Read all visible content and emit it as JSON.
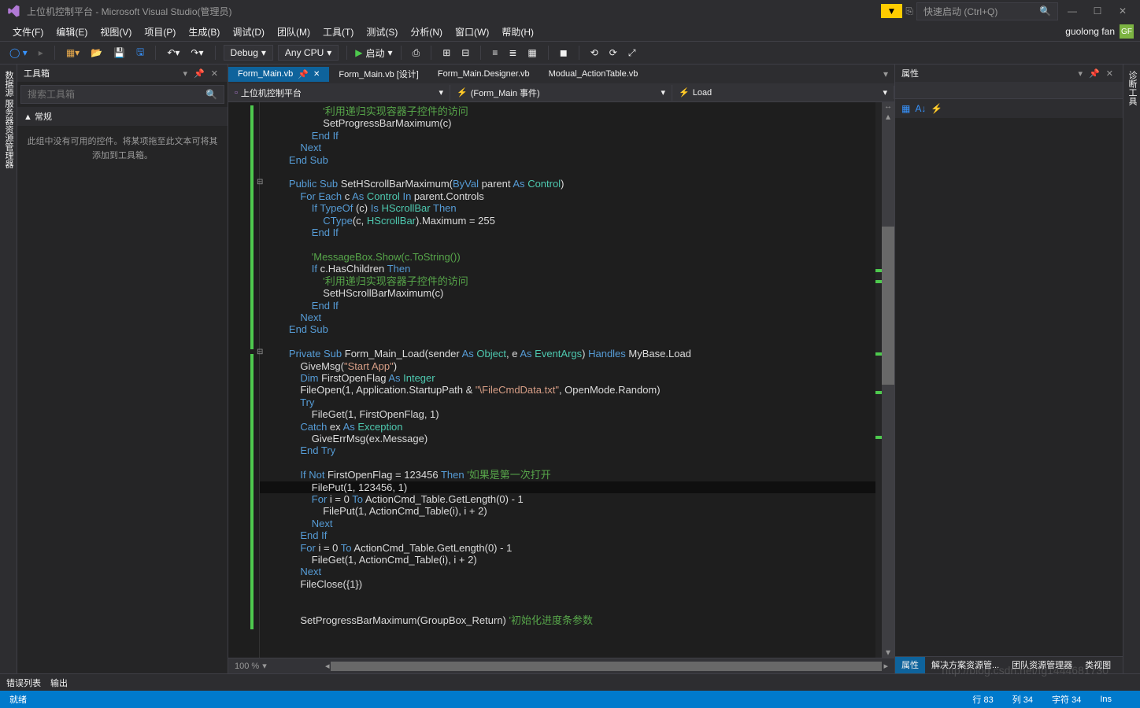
{
  "window": {
    "title": "上位机控制平台 - Microsoft Visual Studio(管理员)",
    "quick_launch_placeholder": "快速启动 (Ctrl+Q)",
    "user_name": "guolong fan",
    "user_initials": "GF"
  },
  "menu": {
    "items": [
      "文件(F)",
      "编辑(E)",
      "视图(V)",
      "项目(P)",
      "生成(B)",
      "调试(D)",
      "团队(M)",
      "工具(T)",
      "测试(S)",
      "分析(N)",
      "窗口(W)",
      "帮助(H)"
    ]
  },
  "toolbar": {
    "config": "Debug",
    "platform": "Any CPU",
    "start_label": "启动"
  },
  "toolbox": {
    "title": "工具箱",
    "search_placeholder": "搜索工具箱",
    "section": "▲ 常规",
    "empty_msg": "此组中没有可用的控件。将某项拖至此文本可将其添加到工具箱。"
  },
  "side_tabs": {
    "left1": "数据源",
    "left2": "服务器资源管理器",
    "right": "诊断工具"
  },
  "tabs": {
    "items": [
      {
        "label": "Form_Main.vb",
        "active": true,
        "pinned": true
      },
      {
        "label": "Form_Main.vb [设计]",
        "active": false
      },
      {
        "label": "Form_Main.Designer.vb",
        "active": false
      },
      {
        "label": "Modual_ActionTable.vb",
        "active": false
      }
    ]
  },
  "navbar": {
    "project": "上位机控制平台",
    "class": "(Form_Main 事件)",
    "method": "Load"
  },
  "code": {
    "lines": [
      {
        "t": "                    '利用递归实现容器子控件的访问",
        "cls": "comment"
      },
      {
        "t": "                    SetProgressBarMaximum(c)"
      },
      {
        "t": "                End If",
        "kw": [
          "End",
          "If"
        ]
      },
      {
        "t": "            Next",
        "kw": [
          "Next"
        ]
      },
      {
        "t": "        End Sub",
        "kw": [
          "End",
          "Sub"
        ]
      },
      {
        "blank": true
      },
      {
        "t": "        Public Sub SetHScrollBarMaximum(ByVal parent As Control)",
        "kw": [
          "Public",
          "Sub",
          "ByVal",
          "As"
        ],
        "type": [
          "Control"
        ]
      },
      {
        "t": "            For Each c As Control In parent.Controls",
        "kw": [
          "For",
          "Each",
          "As",
          "In"
        ],
        "type": [
          "Control"
        ]
      },
      {
        "t": "                If TypeOf (c) Is HScrollBar Then",
        "kw": [
          "If",
          "TypeOf",
          "Is",
          "Then"
        ],
        "type": [
          "HScrollBar"
        ]
      },
      {
        "t": "                    CType(c, HScrollBar).Maximum = 255",
        "kw": [
          "CType"
        ],
        "type": [
          "HScrollBar"
        ]
      },
      {
        "t": "                End If",
        "kw": [
          "End",
          "If"
        ]
      },
      {
        "blank": true
      },
      {
        "t": "                'MessageBox.Show(c.ToString())",
        "cls": "comment"
      },
      {
        "t": "                If c.HasChildren Then",
        "kw": [
          "If",
          "Then"
        ]
      },
      {
        "t": "                    '利用递归实现容器子控件的访问",
        "cls": "comment"
      },
      {
        "t": "                    SetHScrollBarMaximum(c)"
      },
      {
        "t": "                End If",
        "kw": [
          "End",
          "If"
        ]
      },
      {
        "t": "            Next",
        "kw": [
          "Next"
        ]
      },
      {
        "t": "        End Sub",
        "kw": [
          "End",
          "Sub"
        ]
      },
      {
        "blank": true
      },
      {
        "t": "        Private Sub Form_Main_Load(sender As Object, e As EventArgs) Handles MyBase.Load",
        "kw": [
          "Private",
          "Sub",
          "As",
          "As",
          "Handles"
        ],
        "type": [
          "Object",
          "EventArgs"
        ]
      },
      {
        "t": "            GiveMsg(\"Start App\")",
        "str": [
          "\"Start App\""
        ]
      },
      {
        "t": "            Dim FirstOpenFlag As Integer",
        "kw": [
          "Dim",
          "As"
        ],
        "type": [
          "Integer"
        ]
      },
      {
        "t": "            FileOpen(1, Application.StartupPath & \"\\FileCmdData.txt\", OpenMode.Random)",
        "str": [
          "\"\\\\FileCmdData.txt\""
        ]
      },
      {
        "t": "            Try",
        "kw": [
          "Try"
        ]
      },
      {
        "t": "                FileGet(1, FirstOpenFlag, 1)"
      },
      {
        "t": "            Catch ex As Exception",
        "kw": [
          "Catch",
          "As"
        ],
        "type": [
          "Exception"
        ]
      },
      {
        "t": "                GiveErrMsg(ex.Message)"
      },
      {
        "t": "            End Try",
        "kw": [
          "End",
          "Try"
        ]
      },
      {
        "blank": true
      },
      {
        "t": "            If Not FirstOpenFlag = 123456 Then '如果是第一次打开",
        "kw": [
          "If",
          "Not",
          "Then"
        ],
        "comment": "'如果是第一次打开"
      },
      {
        "t": "                FilePut(1, 123456, 1)",
        "cursor": true
      },
      {
        "t": "                For i = 0 To ActionCmd_Table.GetLength(0) - 1",
        "kw": [
          "For",
          "To"
        ]
      },
      {
        "t": "                    FilePut(1, ActionCmd_Table(i), i + 2)"
      },
      {
        "t": "                Next",
        "kw": [
          "Next"
        ]
      },
      {
        "t": "            End If",
        "kw": [
          "End",
          "If"
        ]
      },
      {
        "t": "            For i = 0 To ActionCmd_Table.GetLength(0) - 1",
        "kw": [
          "For",
          "To"
        ]
      },
      {
        "t": "                FileGet(1, ActionCmd_Table(i), i + 2)"
      },
      {
        "t": "            Next",
        "kw": [
          "Next"
        ]
      },
      {
        "t": "            FileClose({1})"
      },
      {
        "blank": true
      },
      {
        "blank": true
      },
      {
        "t": "            SetProgressBarMaximum(GroupBox_Return) '初始化进度条参数",
        "comment": "'初始化进度条参数"
      }
    ]
  },
  "zoom": "100 %",
  "props": {
    "title": "属性",
    "tabs": [
      "属性",
      "解决方案资源管...",
      "团队资源管理器",
      "类视图"
    ]
  },
  "bottom": {
    "tabs": [
      "错误列表",
      "输出"
    ]
  },
  "statusbar": {
    "ready": "就绪",
    "line": "行 83",
    "col": "列 34",
    "char": "字符 34",
    "ins": "Ins"
  },
  "watermark": "http://blog.csdn.net/fg1444681730"
}
